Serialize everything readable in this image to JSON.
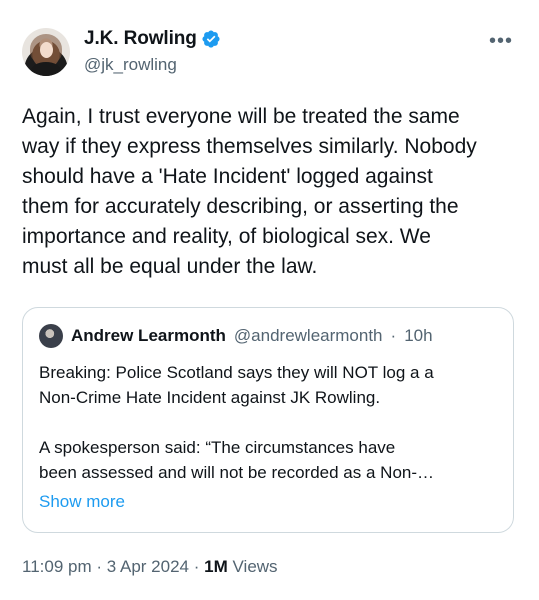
{
  "author": {
    "display_name": "J.K. Rowling",
    "handle": "@jk_rowling",
    "verified_icon": "verified-badge-icon"
  },
  "tweet": {
    "text": "Again, I trust everyone will be treated the same\nway if they express themselves similarly. Nobody\nshould have a 'Hate Incident' logged against\nthem for accurately describing, or asserting the\nimportance and reality, of biological sex. We\nmust all be equal under the law."
  },
  "quoted_tweet": {
    "display_name": "Andrew Learmonth",
    "handle": "@andrewlearmonth",
    "separator": "·",
    "time": "10h",
    "text": "Breaking: Police Scotland says they will NOT log a a\nNon-Crime Hate Incident against JK Rowling.\n\nA spokesperson said: “The circumstances have\nbeen assessed and will not be recorded as a Non-…",
    "show_more": "Show more"
  },
  "meta": {
    "time": "11:09 pm",
    "sep1": "·",
    "date": "3 Apr 2024",
    "sep2": "·",
    "views_count": "1M",
    "views_label": "Views"
  },
  "colors": {
    "text": "#0f1419",
    "secondary": "#536471",
    "link": "#1d9bf0",
    "border": "#cfd9de"
  }
}
